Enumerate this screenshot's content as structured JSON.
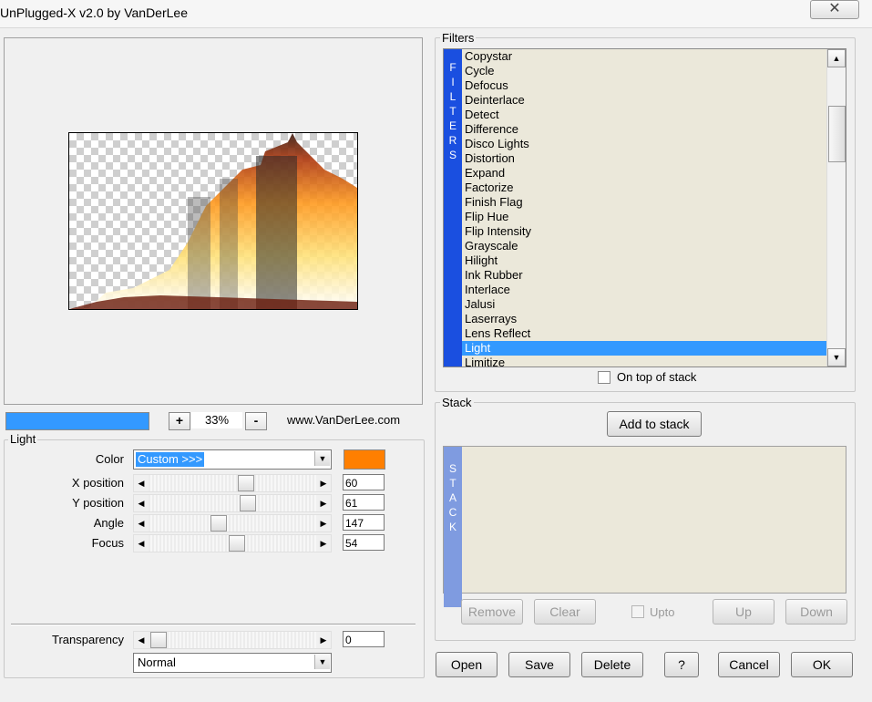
{
  "window": {
    "title": "UnPlugged-X v2.0 by VanDerLee",
    "close": "✕"
  },
  "preview": {
    "zoom": "33%",
    "zoom_in": "+",
    "zoom_out": "-",
    "website": "www.VanDerLee.com",
    "progress": 1.0
  },
  "light": {
    "group_label": "Light",
    "color_label": "Color",
    "color_value": "Custom >>>",
    "swatch": "#ff7f00",
    "x_label": "X position",
    "x_value": "60",
    "y_label": "Y position",
    "y_value": "61",
    "angle_label": "Angle",
    "angle_value": "147",
    "focus_label": "Focus",
    "focus_value": "54",
    "transparency_label": "Transparency",
    "transparency_value": "0",
    "blend_value": "Normal"
  },
  "filters": {
    "group_label": "Filters",
    "strip": [
      "F",
      "I",
      "L",
      "T",
      "E",
      "R",
      "S"
    ],
    "items": [
      "Copystar",
      "Cycle",
      "Defocus",
      "Deinterlace",
      "Detect",
      "Difference",
      "Disco Lights",
      "Distortion",
      "Expand",
      "Factorize",
      "Finish Flag",
      "Flip Hue",
      "Flip Intensity",
      "Grayscale",
      "Hilight",
      "Ink Rubber",
      "Interlace",
      "Jalusi",
      "Laserrays",
      "Lens Reflect",
      "Light",
      "Limitize"
    ],
    "selected": "Light",
    "on_top_label": "On top of stack"
  },
  "stack": {
    "group_label": "Stack",
    "add_button": "Add to stack",
    "strip": [
      "S",
      "T",
      "A",
      "C",
      "K"
    ],
    "remove": "Remove",
    "clear": "Clear",
    "upto": "Upto",
    "up": "Up",
    "down": "Down"
  },
  "footer": {
    "open": "Open",
    "save": "Save",
    "delete": "Delete",
    "help": "?",
    "cancel": "Cancel",
    "ok": "OK"
  },
  "colors": {
    "accent": "#3399ff",
    "filter_strip": "#1a4fe0",
    "stack_strip": "#7f9be0",
    "list_bg": "#ebe8da"
  }
}
